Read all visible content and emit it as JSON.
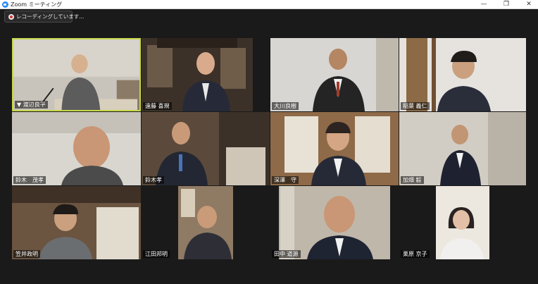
{
  "window": {
    "title": "Zoom ミーティング",
    "minimize_icon": "minimize-icon",
    "maximize_icon": "restore-icon",
    "close_icon": "close-icon"
  },
  "recording": {
    "label": "レコーディングしています...",
    "icon": "record-icon"
  },
  "colors": {
    "active_speaker_border": "#c6d84a",
    "background": "#1a1a1a",
    "recording_red": "#d9302c"
  },
  "participants": [
    {
      "name": "渡辺良平",
      "active": true,
      "muted_icon": "mic-muted-icon"
    },
    {
      "name": "遠藤 喜規",
      "active": false
    },
    {
      "name": "大川良樹",
      "active": false
    },
    {
      "name": "稲葉 義仁",
      "active": false
    },
    {
      "name": "鈴木　茂孝",
      "active": false
    },
    {
      "name": "鈴木孝",
      "active": false
    },
    {
      "name": "深澤　守",
      "active": false
    },
    {
      "name": "加畑 毅",
      "active": false
    },
    {
      "name": "笠井政明",
      "active": false
    },
    {
      "name": "江田邦明",
      "active": false
    },
    {
      "name": "田中 道源",
      "active": false
    },
    {
      "name": "栗原 京子",
      "active": false
    }
  ]
}
